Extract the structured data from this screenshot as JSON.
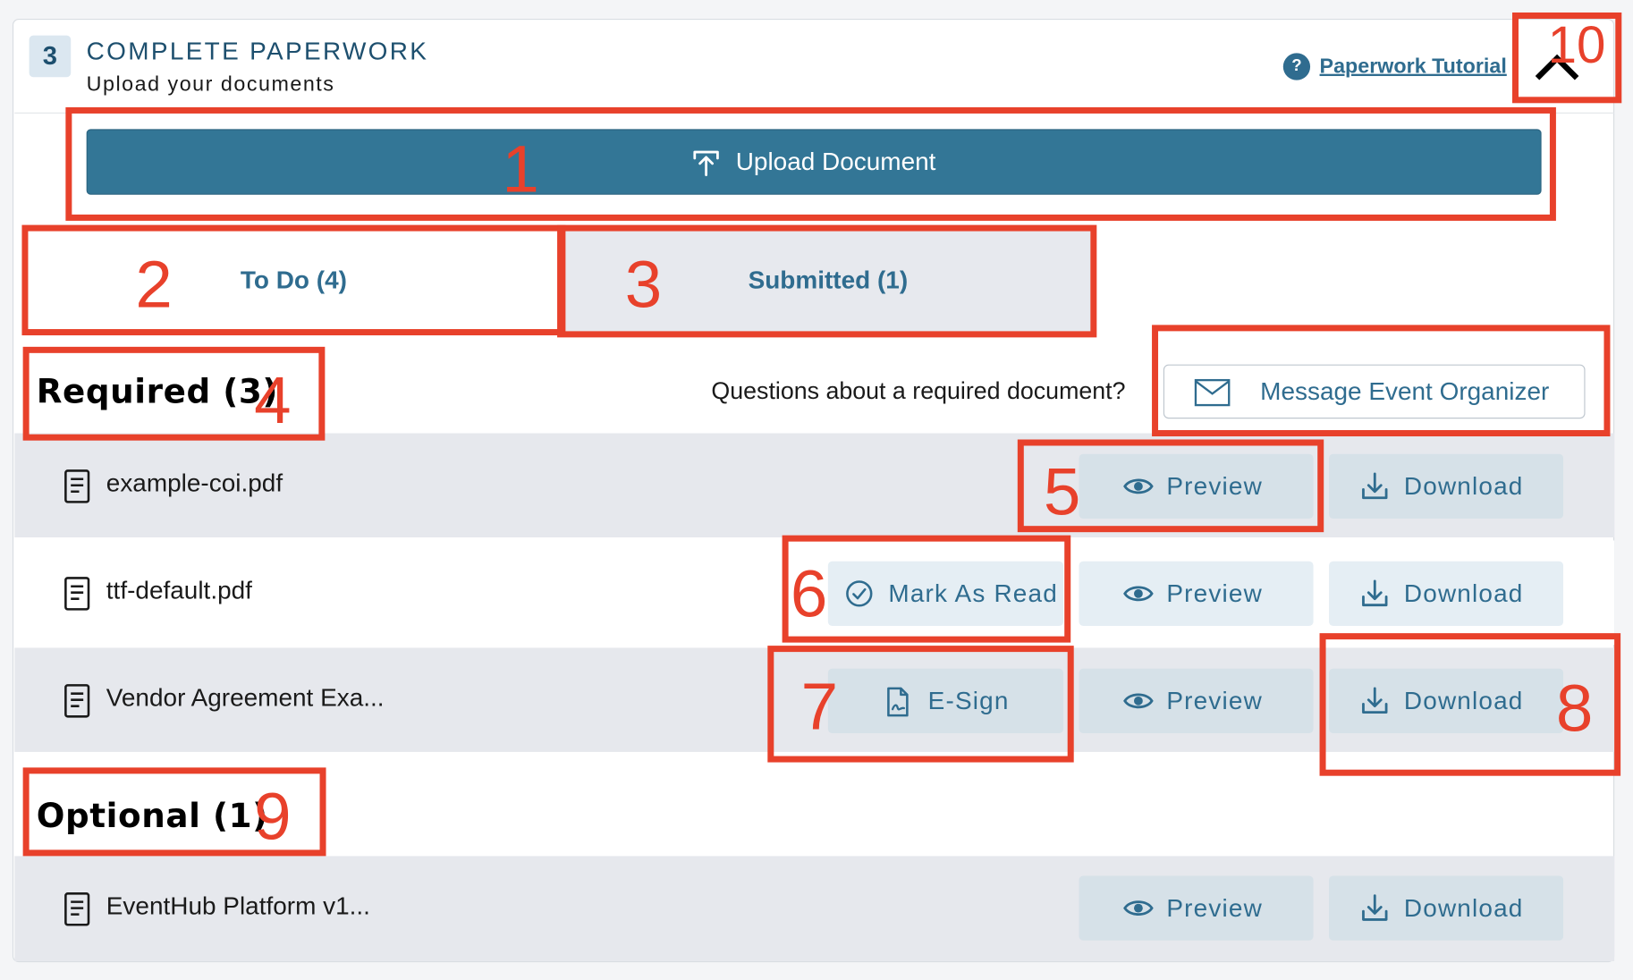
{
  "header": {
    "step_number": "3",
    "title": "COMPLETE PAPERWORK",
    "subtitle": "Upload your documents",
    "tutorial_icon": "?",
    "tutorial_link": "Paperwork Tutorial",
    "collapse_icon": "chevron-up-icon"
  },
  "upload": {
    "label": "Upload Document",
    "icon": "upload-arrow-icon"
  },
  "tabs": [
    {
      "label": "To Do (4)",
      "active": true
    },
    {
      "label": "Submitted (1)",
      "active": false
    }
  ],
  "required": {
    "title": "Required (3)",
    "question": "Questions about a required document?",
    "message_button": "Message Event Organizer",
    "documents": [
      {
        "name": "example-coi.pdf",
        "actions": [
          "Preview",
          "Download"
        ]
      },
      {
        "name": "ttf-default.pdf",
        "actions": [
          "Mark As Read",
          "Preview",
          "Download"
        ]
      },
      {
        "name": "Vendor Agreement Exa...",
        "actions": [
          "E-Sign",
          "Preview",
          "Download"
        ]
      }
    ]
  },
  "optional": {
    "title": "Optional (1)",
    "documents": [
      {
        "name": "EventHub Platform v1...",
        "actions": [
          "Preview",
          "Download"
        ]
      }
    ]
  },
  "annotations": [
    "1",
    "2",
    "3",
    "4",
    "5",
    "6",
    "7",
    "8",
    "9",
    "10"
  ],
  "colors": {
    "accent": "#2f6c8f",
    "upload_button": "#337696",
    "annotation": "#e8412b",
    "row_shade": "#e6e8ed"
  }
}
